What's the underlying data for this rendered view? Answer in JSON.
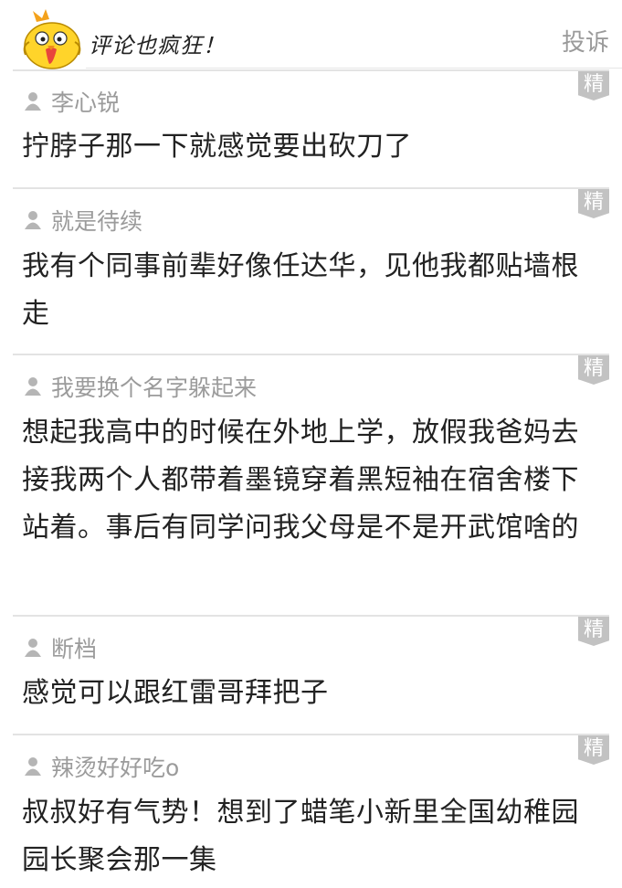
{
  "header": {
    "title": "评论也疯狂！",
    "report_label": "投诉"
  },
  "badge_label": "精",
  "comments": [
    {
      "username": "李心锐",
      "text": "拧脖子那一下就感觉要出砍刀了"
    },
    {
      "username": "就是待续",
      "text": "我有个同事前辈好像任达华，见他我都贴墙根走"
    },
    {
      "username": "我要换个名字躲起来",
      "text": "想起我高中的时候在外地上学，放假我爸妈去接我两个人都带着墨镜穿着黑短袖在宿舍楼下站着。事后有同学问我父母是不是开武馆啥的"
    },
    {
      "username": "断档",
      "text": "感觉可以跟红雷哥拜把子"
    },
    {
      "username": "辣烫好好吃o",
      "text": "叔叔好有气势！想到了蜡笔小新里全国幼稚园园长聚会那一集"
    }
  ]
}
